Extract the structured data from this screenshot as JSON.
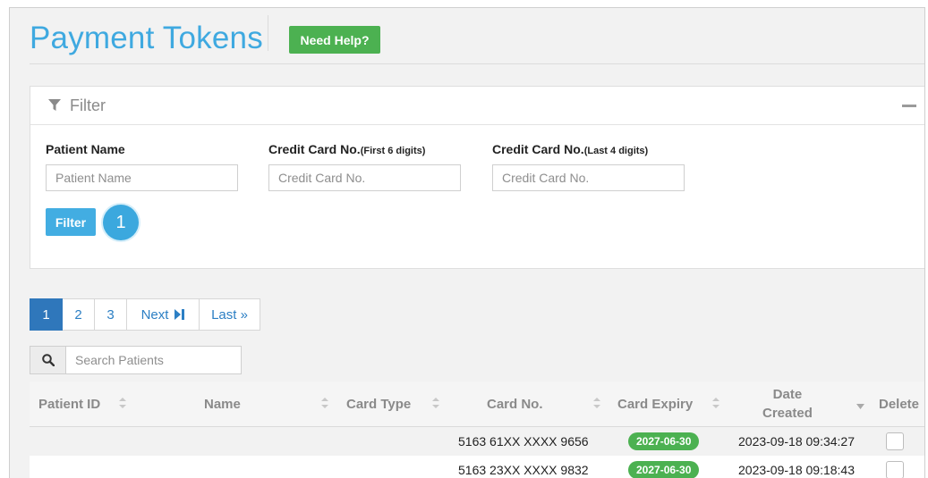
{
  "header": {
    "title": "Payment Tokens",
    "help_label": "Need Help?"
  },
  "filter": {
    "heading": "Filter",
    "fields": [
      {
        "label": "Patient Name",
        "sub": "",
        "placeholder": "Patient Name"
      },
      {
        "label": "Credit Card No.",
        "sub": "(First 6 digits)",
        "placeholder": "Credit Card No."
      },
      {
        "label": "Credit Card No.",
        "sub": "(Last 4 digits)",
        "placeholder": "Credit Card No."
      }
    ],
    "button_label": "Filter",
    "step_badge": "1"
  },
  "pagination": {
    "pages": [
      "1",
      "2",
      "3"
    ],
    "next": "Next",
    "last": "Last »"
  },
  "search": {
    "placeholder": "Search Patients"
  },
  "table": {
    "columns": [
      "Patient ID",
      "Name",
      "Card Type",
      "Card No.",
      "Card Expiry",
      "Date",
      "Created",
      "Delete"
    ],
    "rows": [
      {
        "patient_id": "",
        "name": "",
        "card_type": "",
        "card_no": "5163 61XX XXXX 9656",
        "expiry": "2027-06-30",
        "created": "2023-09-18 09:34:27"
      },
      {
        "patient_id": "",
        "name": "",
        "card_type": "",
        "card_no": "5163 23XX XXXX 9832",
        "expiry": "2027-06-30",
        "created": "2023-09-18 09:18:43"
      }
    ]
  },
  "colors": {
    "accent": "#3fa9e0",
    "help_green": "#4cb151",
    "active_page": "#2f77bb"
  }
}
